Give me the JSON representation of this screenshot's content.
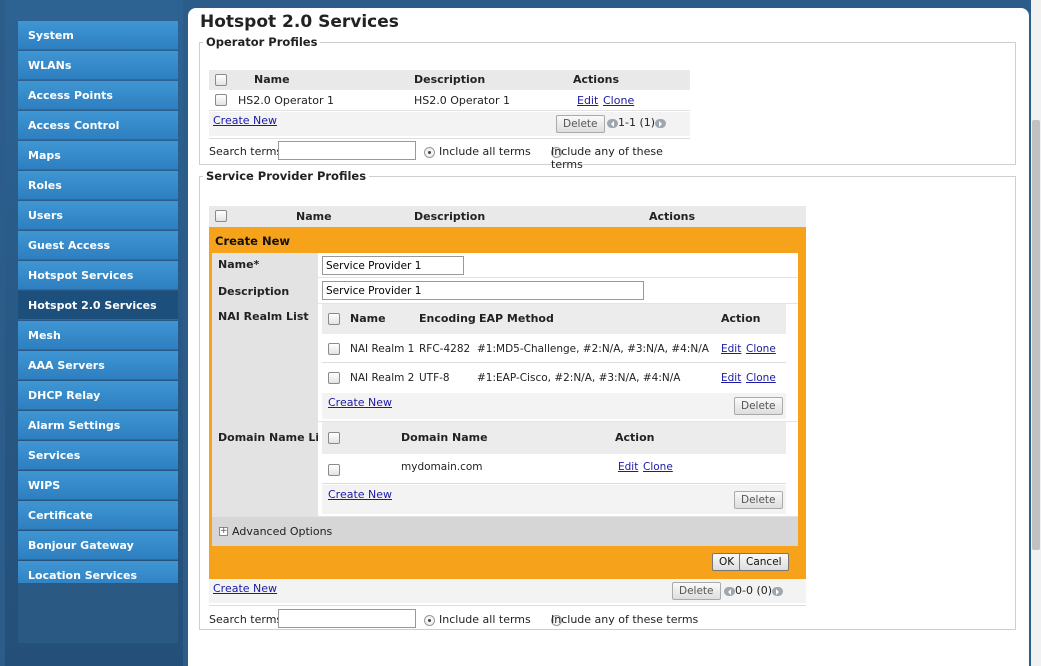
{
  "sidebar": {
    "items": [
      {
        "label": "System"
      },
      {
        "label": "WLANs"
      },
      {
        "label": "Access Points"
      },
      {
        "label": "Access Control"
      },
      {
        "label": "Maps"
      },
      {
        "label": "Roles"
      },
      {
        "label": "Users"
      },
      {
        "label": "Guest Access"
      },
      {
        "label": "Hotspot Services"
      },
      {
        "label": "Hotspot 2.0 Services"
      },
      {
        "label": "Mesh"
      },
      {
        "label": "AAA Servers"
      },
      {
        "label": "DHCP Relay"
      },
      {
        "label": "Alarm Settings"
      },
      {
        "label": "Services"
      },
      {
        "label": "WIPS"
      },
      {
        "label": "Certificate"
      },
      {
        "label": "Bonjour Gateway"
      },
      {
        "label": "Location Services"
      }
    ],
    "active_index": 9
  },
  "page": {
    "title": "Hotspot 2.0 Services"
  },
  "operator": {
    "legend": "Operator Profiles",
    "columns": [
      "Name",
      "Description",
      "Actions"
    ],
    "rows": [
      {
        "name": "HS2.0 Operator 1",
        "description": "HS2.0 Operator 1",
        "edit": "Edit",
        "clone": "Clone"
      }
    ],
    "create_new": "Create New",
    "delete": "Delete",
    "pager": "1-1 (1)",
    "search_label": "Search terms",
    "search_value": "",
    "include_all": "Include all terms",
    "include_any": "Include any of these terms"
  },
  "provider": {
    "legend": "Service Provider Profiles",
    "columns": [
      "Name",
      "Description",
      "Actions"
    ],
    "form": {
      "header": "Create New",
      "name_label": "Name*",
      "name_value": "Service Provider 1",
      "description_label": "Description",
      "description_value": "Service Provider 1",
      "nai": {
        "label": "NAI Realm List",
        "columns": [
          "Name",
          "Encoding",
          "EAP Method",
          "Action"
        ],
        "rows": [
          {
            "name": "NAI Realm 1",
            "encoding": "RFC-4282",
            "eap": "#1:MD5-Challenge, #2:N/A, #3:N/A, #4:N/A",
            "edit": "Edit",
            "clone": "Clone"
          },
          {
            "name": "NAI Realm 2",
            "encoding": "UTF-8",
            "eap": "#1:EAP-Cisco, #2:N/A, #3:N/A, #4:N/A",
            "edit": "Edit",
            "clone": "Clone"
          }
        ],
        "create_new": "Create New",
        "delete": "Delete"
      },
      "domain": {
        "label": "Domain Name List",
        "columns": [
          "Domain Name",
          "Action"
        ],
        "rows": [
          {
            "name": "mydomain.com",
            "edit": "Edit",
            "clone": "Clone"
          }
        ],
        "create_new": "Create New",
        "delete": "Delete"
      },
      "advanced": "Advanced Options",
      "ok": "OK",
      "cancel": "Cancel"
    },
    "create_new": "Create New",
    "delete": "Delete",
    "pager": "0-0 (0)",
    "search_label": "Search terms",
    "search_value": "",
    "include_all": "Include all terms",
    "include_any": "Include any of these terms"
  },
  "colors": {
    "accent_orange": "#f7a21b",
    "sidebar_blue": "#3a8fd0",
    "sidebar_active": "#1d4f7c"
  }
}
